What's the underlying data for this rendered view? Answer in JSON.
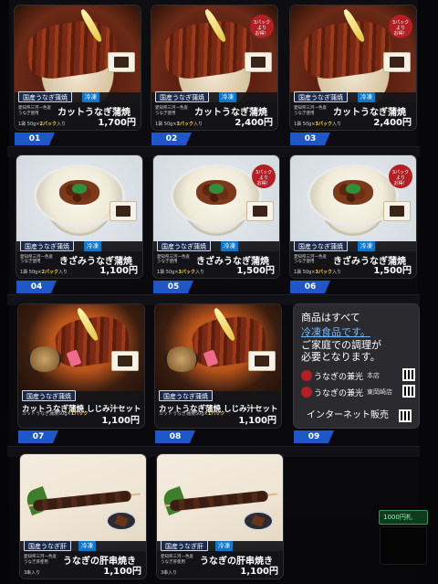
{
  "products": [
    {
      "slot": "01",
      "tag": "国産うなぎ蒲焼",
      "frozen": "冷凍",
      "note": "愛知県三河一色産\nうなぎ使用",
      "name": "カットうなぎ蒲焼",
      "sub_prefix": "1袋 50g×",
      "sub_bold": "2パック",
      "sub_suffix": "入り",
      "price": "1,700円",
      "promo": ""
    },
    {
      "slot": "02",
      "tag": "国産うなぎ蒲焼",
      "frozen": "冷凍",
      "note": "愛知県三河一色産\nうなぎ使用",
      "name": "カットうなぎ蒲焼",
      "sub_prefix": "1袋 50g×",
      "sub_bold": "3パック",
      "sub_suffix": "入り",
      "price": "2,400円",
      "promo": "3パック\nより\nお得！"
    },
    {
      "slot": "03",
      "tag": "国産うなぎ蒲焼",
      "frozen": "冷凍",
      "note": "愛知県三河一色産\nうなぎ使用",
      "name": "カットうなぎ蒲焼",
      "sub_prefix": "1袋 50g×",
      "sub_bold": "3パック",
      "sub_suffix": "入り",
      "price": "2,400円",
      "promo": "3パック\nより\nお得！"
    },
    {
      "slot": "04",
      "tag": "国産うなぎ蒲焼",
      "frozen": "冷凍",
      "note": "愛知県三河一色産\nうなぎ使用",
      "name": "きざみうなぎ蒲焼",
      "sub_prefix": "1袋 50g×",
      "sub_bold": "2パック",
      "sub_suffix": "入り",
      "price": "1,100円",
      "promo": ""
    },
    {
      "slot": "05",
      "tag": "国産うなぎ蒲焼",
      "frozen": "冷凍",
      "note": "愛知県三河一色産\nうなぎ使用",
      "name": "きざみうなぎ蒲焼",
      "sub_prefix": "1袋 50g×",
      "sub_bold": "3パック",
      "sub_suffix": "入り",
      "price": "1,500円",
      "promo": "3パック\nより\nお得！"
    },
    {
      "slot": "06",
      "tag": "国産うなぎ蒲焼",
      "frozen": "冷凍",
      "note": "愛知県三河一色産\nうなぎ使用",
      "name": "きざみうなぎ蒲焼",
      "sub_prefix": "1袋 50g×",
      "sub_bold": "3パック",
      "sub_suffix": "入り",
      "price": "1,500円",
      "promo": "3パック\nより\nお得！"
    },
    {
      "slot": "07",
      "tag": "国産うなぎ蒲焼",
      "frozen": "",
      "note": "",
      "name": "カットうなぎ蒲焼 しじみ汁セット",
      "sub_prefix": "カットうなぎ蒲焼50g×",
      "sub_bold": "1パック",
      "sub_suffix": "",
      "price": "1,100円",
      "promo": ""
    },
    {
      "slot": "08",
      "tag": "国産うなぎ蒲焼",
      "frozen": "",
      "note": "",
      "name": "カットうなぎ蒲焼 しじみ汁セット",
      "sub_prefix": "カットうなぎ蒲焼50g×",
      "sub_bold": "1パック",
      "sub_suffix": "",
      "price": "1,100円",
      "promo": ""
    },
    {
      "slot": "",
      "tag": "国産うなぎ肝",
      "frozen": "冷凍",
      "note": "愛知県三河一色産\nうなぎ肝使用",
      "name": "うなぎの肝串焼き",
      "sub_prefix": "3串入り",
      "sub_bold": "",
      "sub_suffix": "",
      "price": "1,100円",
      "promo": ""
    },
    {
      "slot": "",
      "tag": "国産うなぎ肝",
      "frozen": "冷凍",
      "note": "愛知県三河一色産\nうなぎ肝使用",
      "name": "うなぎの肝串焼き",
      "sub_prefix": "3串入り",
      "sub_bold": "",
      "sub_suffix": "",
      "price": "1,100円",
      "promo": ""
    }
  ],
  "notice": {
    "line1": "商品はすべて",
    "line2": "冷凍食品です。",
    "line3": "ご家庭での調理が",
    "line4": "必要となります。",
    "brand1_name": "うなぎの兼光",
    "brand1_store": "本店",
    "brand2_name": "うなぎの兼光",
    "brand2_store": "東岡崎店",
    "internet": "インターネット販売",
    "slot": "09"
  },
  "coin_slot_label": "1000円札"
}
